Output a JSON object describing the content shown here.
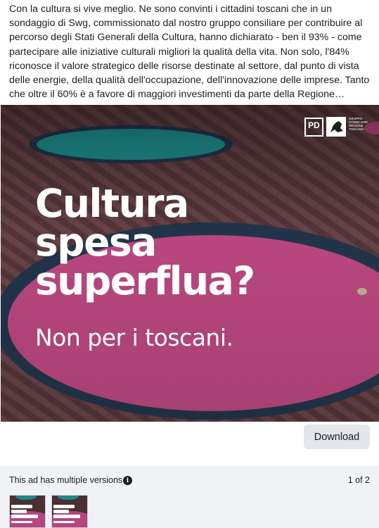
{
  "ad": {
    "body_text": "Con la cultura si vive meglio. Ne sono convinti i cittadini toscani che in un sondaggio di Swg, commissionato dal nostro gruppo consiliare per contribuire al percorso degli Stati Generali della Cultura, hanno dichiarato - ben il 93% - come partecipare alle iniziative culturali migliori la qualità della vita. Non solo, l'84% riconosce il valore strategico delle risorse destinate al settore, dal punto di vista delle energie, della qualità dell'occupazione, dell'innovazione delle imprese. Tanto che oltre il 60% è a favore di maggiori investimenti da parte della Regione Toscana..."
  },
  "creative": {
    "headline_line1": "Cultura",
    "headline_line2": "spesa",
    "headline_line3": "superflua?",
    "subline": "Non per i toscani.",
    "logo_pd": "PD",
    "logo_text": "Gruppo Consiliare Regione Toscana",
    "colors": {
      "circle_pink": "#b9477f",
      "circle_teal": "#1f8f8f",
      "ring_dark": "#2b3a52",
      "pavement": "#5b3b3e"
    }
  },
  "actions": {
    "download_label": "Download"
  },
  "versions": {
    "label": "This ad has multiple versions",
    "info_icon": "info-icon",
    "count": "1 of 2"
  }
}
